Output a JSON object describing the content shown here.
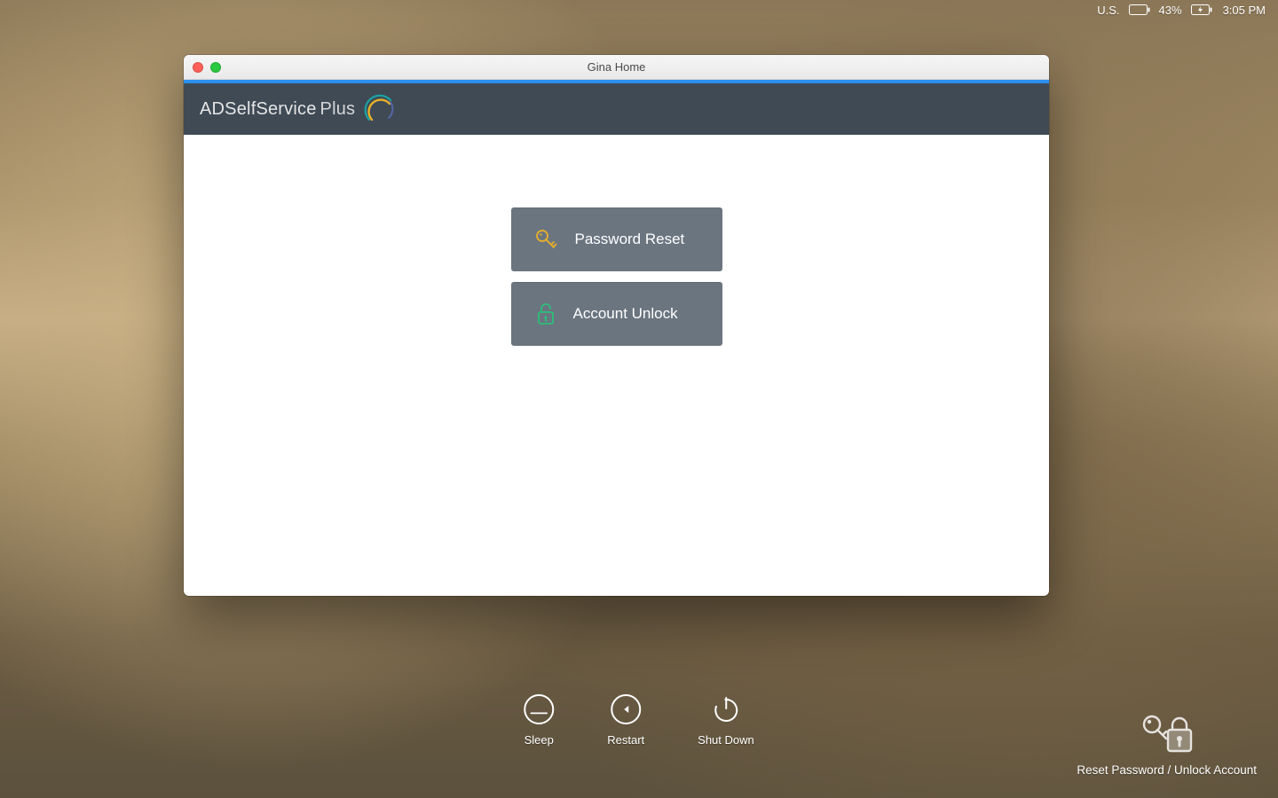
{
  "menubar": {
    "input_source": "U.S.",
    "battery_percent": "43%",
    "time": "3:05 PM"
  },
  "window": {
    "title": "Gina Home"
  },
  "brand": {
    "name_main": "ADSelfService",
    "name_suffix": "Plus"
  },
  "actions": {
    "password_reset": "Password Reset",
    "account_unlock": "Account Unlock"
  },
  "power": {
    "sleep": "Sleep",
    "restart": "Restart",
    "shutdown": "Shut Down"
  },
  "reset_link": "Reset Password / Unlock Account"
}
